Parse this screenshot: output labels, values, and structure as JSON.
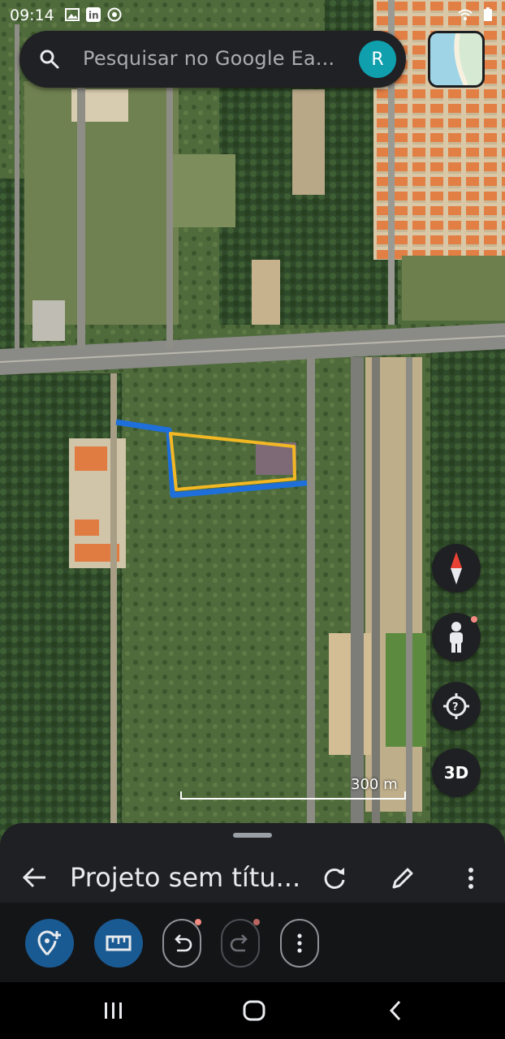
{
  "status_bar": {
    "time": "09:14"
  },
  "search": {
    "placeholder": "Pesquisar no Google Ea...",
    "avatar_letter": "R"
  },
  "map": {
    "scale_label": "300 m"
  },
  "controls": {
    "threed_label": "3D"
  },
  "project": {
    "title": "Projeto sem títu..."
  },
  "icons": {
    "search": "search-icon",
    "compass": "compass-icon",
    "pegman": "pegman-icon",
    "locate": "locate-icon",
    "back": "arrow-left-icon",
    "refresh": "refresh-icon",
    "edit": "pencil-icon",
    "more": "more-vert-icon",
    "add_placemark": "add-location-icon",
    "measure": "ruler-icon",
    "undo": "undo-icon",
    "redo": "redo-icon"
  },
  "colors": {
    "accent_blue": "#1a5a93",
    "avatar": "#0f9fad",
    "polyline_blue": "#1e6fd9",
    "polyline_yellow": "#f2b824",
    "sheet_bg": "#1f2023"
  }
}
